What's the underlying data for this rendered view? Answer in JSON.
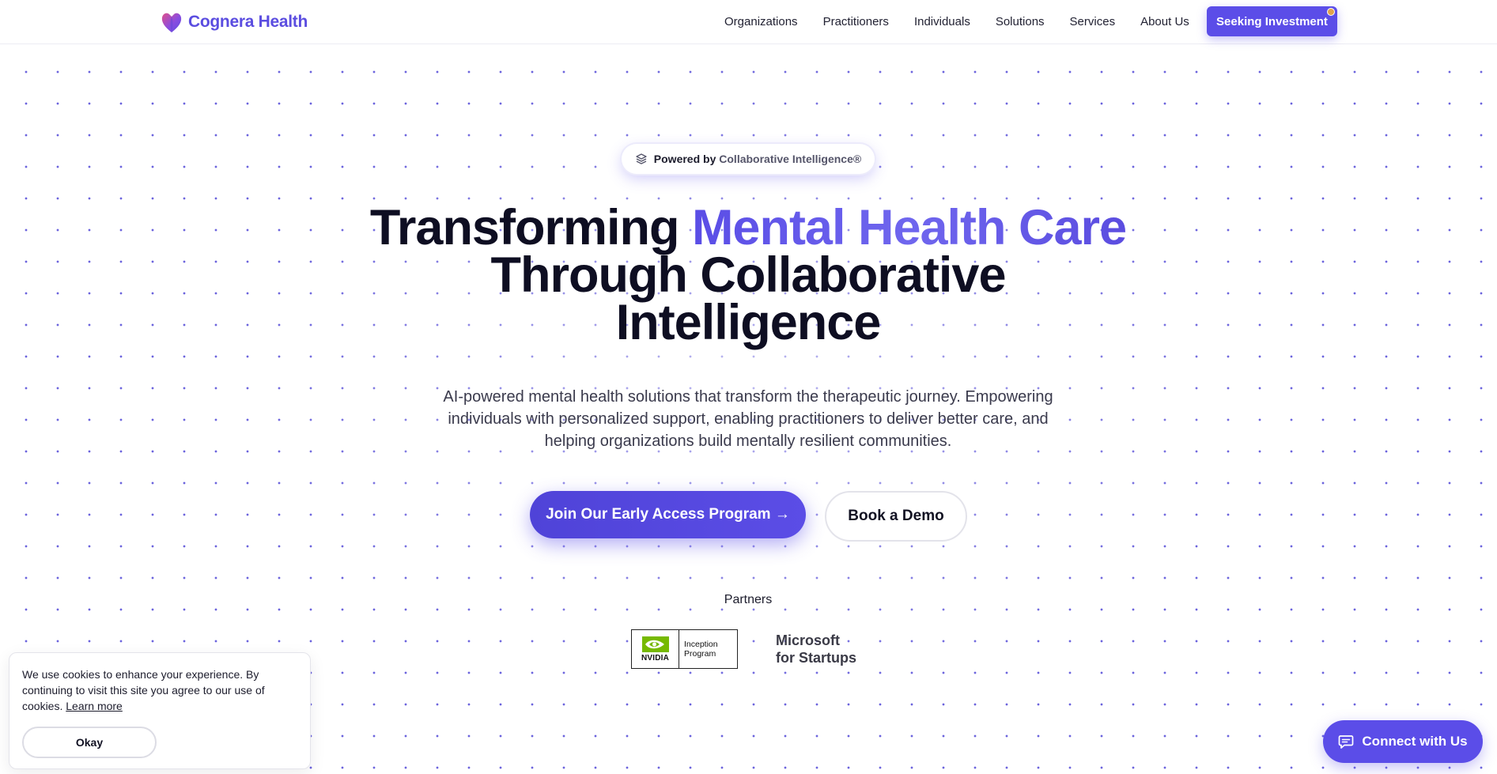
{
  "header": {
    "brand_name": "Cognera Health",
    "nav": [
      "Organizations",
      "Practitioners",
      "Individuals",
      "Solutions",
      "Services",
      "About Us"
    ],
    "cta_label": "Seeking Investment"
  },
  "hero": {
    "badge_prefix": "Powered by ",
    "badge_highlight": "Collaborative Intelligence®",
    "title_part1": "Transforming ",
    "title_highlight": "Mental Health Care",
    "title_part2": " Through Collaborative Intelligence",
    "subtitle": "AI-powered mental health solutions that transform the therapeutic journey. Empowering individuals with personalized support, enabling practitioners to deliver better care, and helping organizations build mentally resilient communities.",
    "primary_button": "Join Our Early Access Program →",
    "secondary_button": "Book a Demo"
  },
  "partners": {
    "label": "Partners",
    "nvidia_word": "NVIDIA",
    "nvidia_line1": "Inception",
    "nvidia_line2": "Program",
    "microsoft_line1": "Microsoft",
    "microsoft_line2": "for Startups"
  },
  "cookie": {
    "text": "We use cookies to enhance your experience. By continuing to visit this site you agree to our use of cookies. ",
    "link": "Learn more",
    "button": "Okay"
  },
  "chat": {
    "label": "Connect with Us"
  },
  "colors": {
    "accent": "#5b4de8",
    "badge_dot": "#e0a24a",
    "dots": "#5b52d9"
  }
}
